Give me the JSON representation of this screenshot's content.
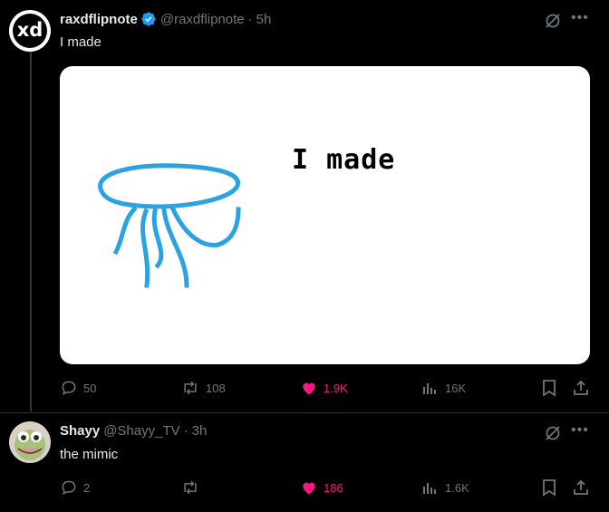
{
  "post": {
    "display_name": "raxdflipnote",
    "handle": "@raxdflipnote",
    "time": "5h",
    "text": "I made",
    "avatar_text": "xd",
    "media_caption": "I made",
    "actions": {
      "replies": "50",
      "reposts": "108",
      "likes": "1.9K",
      "views": "16K"
    }
  },
  "reply": {
    "display_name": "Shayy",
    "handle": "@Shayy_TV",
    "time": "3h",
    "text": "the mimic",
    "actions": {
      "replies": "2",
      "reposts": "",
      "likes": "186",
      "views": "1.6K"
    }
  },
  "colors": {
    "background": "#000000",
    "text": "#e7e9ea",
    "muted": "#71767b",
    "like": "#f91880",
    "verified": "#1d9bf0",
    "drawing": "#2aa3e0"
  },
  "icons": [
    "verified-badge-icon",
    "grok-icon",
    "more-icon",
    "reply-icon",
    "repost-icon",
    "like-icon",
    "views-icon",
    "bookmark-icon",
    "share-icon"
  ]
}
